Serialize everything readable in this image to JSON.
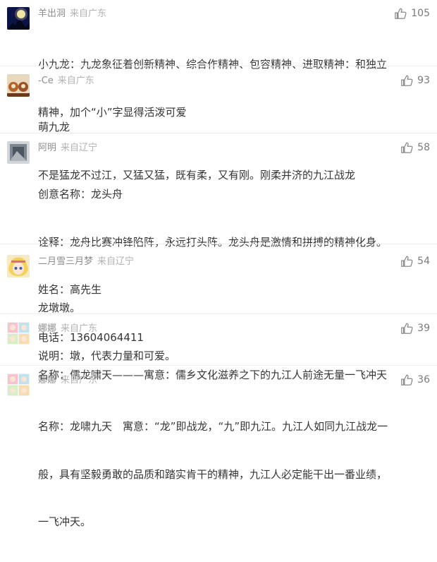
{
  "comments": [
    {
      "user": "羊出洞",
      "location": "来自广东",
      "likes": "105",
      "lines": [
        "小九龙：九龙象征着创新精神、综合作精神、包容精神、进取精神：和独立",
        "精神，加个“小”字显得活泼可爱"
      ]
    },
    {
      "user": "-Ce",
      "location": "来自广东",
      "likes": "93",
      "lines": [
        "萌九龙",
        "不是猛龙不过江，又猛又猛，既有柔，又有刚。刚柔并济的九江战龙"
      ]
    },
    {
      "user": "阿明",
      "location": "来自辽宁",
      "likes": "58",
      "lines": [
        "创意名称：龙头舟",
        "诠释：龙舟比赛冲锋陷阵，永远打头阵。龙头舟是激情和拼搏的精神化身。",
        "姓名：高先生",
        "电话：13604064411"
      ]
    },
    {
      "user": "二月雪三月梦",
      "location": "来自辽宁",
      "likes": "54",
      "lines": [
        "龙墩墩。",
        "说明：墩，代表力量和可爱。"
      ]
    },
    {
      "user": "娜娜",
      "location": "来自广东",
      "likes": "39",
      "lines": [
        "名称：儒龙啸天———寓意：儒乡文化滋养之下的九江人前途无量一飞冲天"
      ]
    },
    {
      "user": "娜娜",
      "location": "来自广东",
      "likes": "36",
      "lines": [
        "名称：龙啸九天　寓意：“龙”即战龙，“九”即九江。九江人如同九江战龙一",
        "般，具有坚毅勇敢的品质和踏实肯干的精神，九江人必定能干出一番业绩，",
        "一飞冲天。"
      ]
    }
  ]
}
